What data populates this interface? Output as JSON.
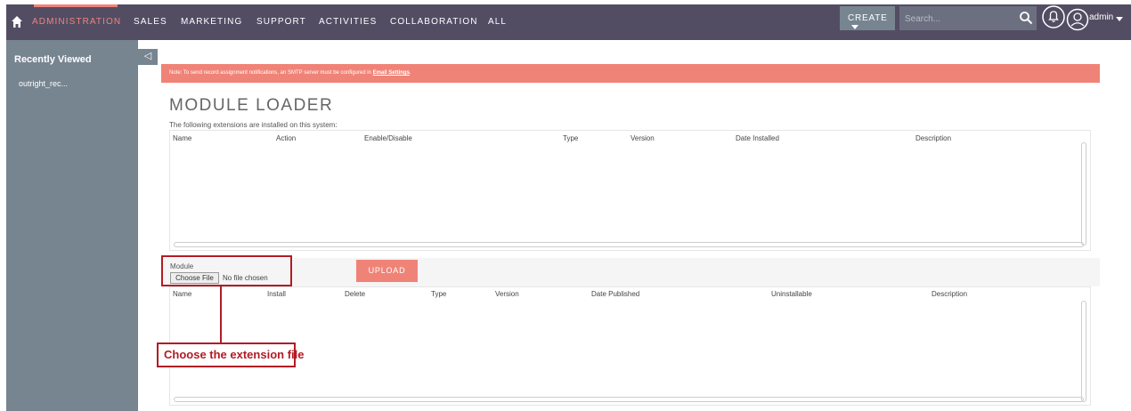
{
  "nav": {
    "items": [
      {
        "label": "ADMINISTRATION",
        "active": true
      },
      {
        "label": "SALES"
      },
      {
        "label": "MARKETING"
      },
      {
        "label": "SUPPORT"
      },
      {
        "label": "ACTIVITIES"
      },
      {
        "label": "COLLABORATION"
      },
      {
        "label": "ALL"
      }
    ],
    "create_label": "CREATE",
    "search_placeholder": "Search...",
    "user_label": "admin"
  },
  "sidebar": {
    "title": "Recently Viewed",
    "items": [
      {
        "label": "outright_rec..."
      }
    ],
    "collapse_glyph": "◁"
  },
  "notice": {
    "text": "Note: To send record assignment notifications, an SMTP server must be configured in ",
    "link": "Email Settings",
    "suffix": "."
  },
  "page": {
    "title": "MODULE LOADER",
    "subtitle": "The following extensions are installed on this system:"
  },
  "installed_table": {
    "columns": [
      "Name",
      "Action",
      "Enable/Disable",
      "Type",
      "Version",
      "Date Installed",
      "Description"
    ],
    "rows": []
  },
  "upload": {
    "module_label": "Module",
    "choose_file_label": "Choose File",
    "no_file_text": "No file chosen",
    "upload_label": "UPLOAD"
  },
  "packages_table": {
    "columns": [
      "Name",
      "Install",
      "Delete",
      "Type",
      "Version",
      "Date Published",
      "Uninstallable",
      "Description"
    ],
    "rows": []
  },
  "annotation": {
    "callout_text": "Choose the extension file"
  },
  "colors": {
    "nav_bg": "#534d64",
    "accent": "#f08377",
    "sidebar_bg": "#778591",
    "annotation": "#b31b25"
  },
  "icons": [
    "home-icon",
    "search-icon",
    "bell-icon",
    "user-icon",
    "collapse-arrow-icon"
  ]
}
